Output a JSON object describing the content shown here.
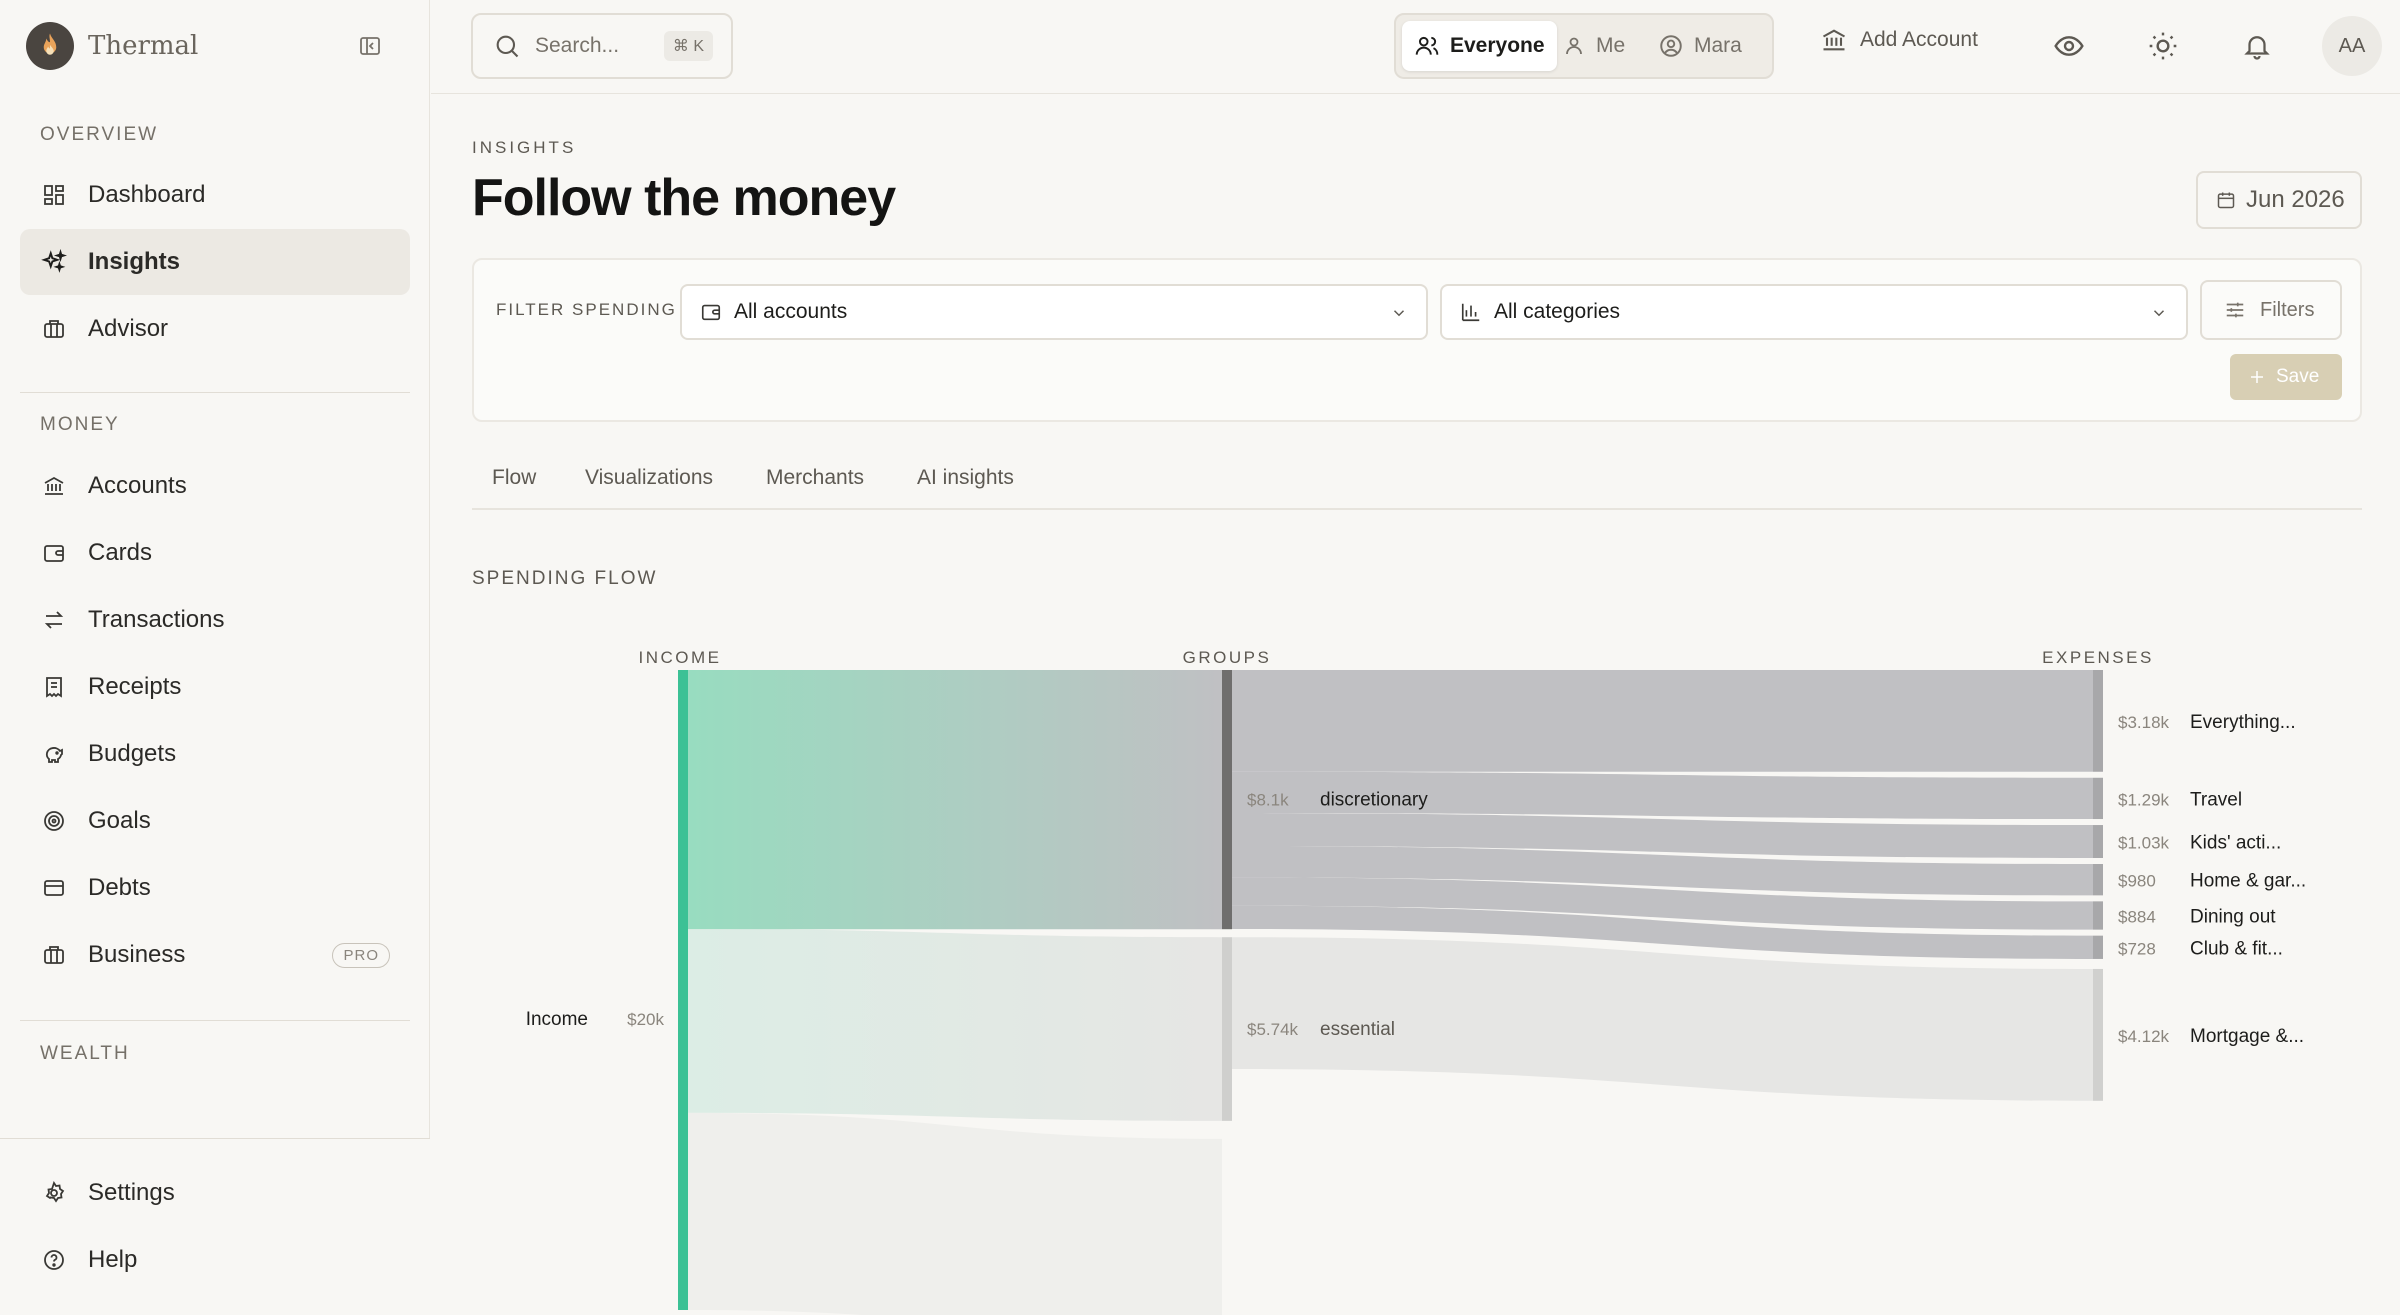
{
  "app": {
    "name": "Thermal"
  },
  "sidebar": {
    "overview_label": "OVERVIEW",
    "overview_items": [
      {
        "label": "Dashboard",
        "icon": "grid-icon"
      },
      {
        "label": "Insights",
        "icon": "sparkles-icon",
        "active": true
      },
      {
        "label": "Advisor",
        "icon": "briefcase-icon"
      }
    ],
    "money_label": "MONEY",
    "money_items": [
      {
        "label": "Accounts",
        "icon": "bank-icon"
      },
      {
        "label": "Cards",
        "icon": "wallet-icon"
      },
      {
        "label": "Transactions",
        "icon": "arrows-icon"
      },
      {
        "label": "Receipts",
        "icon": "receipt-icon"
      },
      {
        "label": "Budgets",
        "icon": "piggy-bank-icon"
      },
      {
        "label": "Goals",
        "icon": "target-icon"
      },
      {
        "label": "Debts",
        "icon": "credit-card-icon"
      },
      {
        "label": "Business",
        "icon": "briefcase-icon",
        "badge": "PRO"
      }
    ],
    "wealth_label": "WEALTH",
    "footer_items": [
      {
        "label": "Settings",
        "icon": "gear-icon"
      },
      {
        "label": "Help",
        "icon": "help-icon"
      }
    ]
  },
  "topbar": {
    "search_placeholder": "Search...",
    "search_shortcut": "⌘ K",
    "scope_options": [
      "Everyone",
      "Me",
      "Mara"
    ],
    "scope_selected": "Everyone",
    "add_account_label": "Add Account",
    "avatar_initials": "AA"
  },
  "page": {
    "eyebrow": "INSIGHTS",
    "title": "Follow the money",
    "date_label": "Jun 2026"
  },
  "filters": {
    "label": "FILTER SPENDING",
    "accounts_value": "All accounts",
    "categories_value": "All categories",
    "filters_label": "Filters",
    "save_label": "Save"
  },
  "tabs": [
    "Flow",
    "Visualizations",
    "Merchants",
    "AI insights"
  ],
  "flow": {
    "heading": "SPENDING FLOW",
    "column_labels": {
      "income": "INCOME",
      "groups": "GROUPS",
      "expenses": "EXPENSES"
    }
  },
  "colors": {
    "accent": "#d8cfb4",
    "income_node": "#3cc195",
    "discretionary_node": "#6f6e6d",
    "essential_node": "#cfcfcd",
    "discretionary_flow": "#c0c0c3",
    "essential_flow": "#e6e6e4"
  },
  "chart_data": {
    "type": "sankey",
    "columns": [
      "INCOME",
      "GROUPS",
      "EXPENSES"
    ],
    "nodes": [
      {
        "id": "income",
        "column": 0,
        "label": "Income",
        "value_label": "$20k",
        "value": 20000
      },
      {
        "id": "discretionary",
        "column": 1,
        "label": "discretionary",
        "value_label": "$8.1k",
        "value": 8100
      },
      {
        "id": "essential",
        "column": 1,
        "label": "essential",
        "value_label": "$5.74k",
        "value": 5740
      },
      {
        "id": "everything",
        "column": 2,
        "label": "Everything...",
        "value_label": "$3.18k",
        "value": 3180,
        "group": "discretionary"
      },
      {
        "id": "travel",
        "column": 2,
        "label": "Travel",
        "value_label": "$1.29k",
        "value": 1290,
        "group": "discretionary"
      },
      {
        "id": "kids",
        "column": 2,
        "label": "Kids' acti...",
        "value_label": "$1.03k",
        "value": 1030,
        "group": "discretionary"
      },
      {
        "id": "home",
        "column": 2,
        "label": "Home & gar...",
        "value_label": "$980",
        "value": 980,
        "group": "discretionary"
      },
      {
        "id": "dining",
        "column": 2,
        "label": "Dining out",
        "value_label": "$884",
        "value": 884,
        "group": "discretionary"
      },
      {
        "id": "club",
        "column": 2,
        "label": "Club & fit...",
        "value_label": "$728",
        "value": 728,
        "group": "discretionary"
      },
      {
        "id": "mortgage",
        "column": 2,
        "label": "Mortgage &...",
        "value_label": "$4.12k",
        "value": 4120,
        "group": "essential"
      }
    ]
  }
}
